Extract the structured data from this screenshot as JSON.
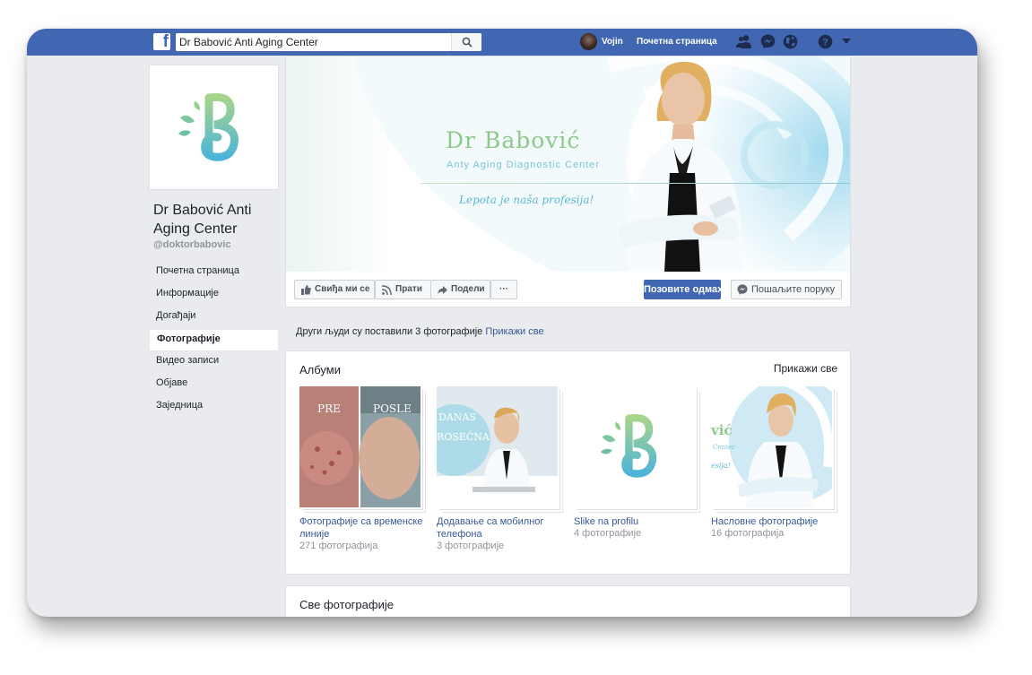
{
  "topbar": {
    "search_value": "Dr Babović Anti Aging Center",
    "user_name": "Vojin",
    "home_label": "Почетна страница",
    "icons": [
      "facebook-icon",
      "search-icon",
      "friends-icon",
      "messenger-icon",
      "globe-icon",
      "help-icon",
      "dropdown-icon"
    ]
  },
  "sidebar": {
    "page_name": "Dr Babović Anti Aging Center",
    "handle": "@doktorbabovic",
    "nav": [
      {
        "label": "Почетна страница"
      },
      {
        "label": "Информације"
      },
      {
        "label": "Догађаји"
      },
      {
        "label": "Фотографије",
        "active": true
      },
      {
        "label": "Видео записи"
      },
      {
        "label": "Објаве"
      },
      {
        "label": "Заједница"
      }
    ]
  },
  "cover": {
    "title": "Dr Babović",
    "subtitle": "Anty Aging Diagnostic Center",
    "slogan": "Lepota je naša profesija!"
  },
  "actions": {
    "like": "Свиђа ми се",
    "follow": "Прати",
    "share": "Подели",
    "more": "···",
    "call": "Позовите одмах",
    "message": "Пошаљите поруку"
  },
  "others": {
    "text": "Други људи су поставили 3 фотографије",
    "link": "Прикажи све"
  },
  "albums": {
    "title": "Албуми",
    "see_all": "Прикажи све",
    "items": [
      {
        "name": "Фотографије са временске линије",
        "count": "271 фотографија",
        "thumb_text": [
          "PRE",
          "POSLE"
        ]
      },
      {
        "name": "Додавање са мобилног телефона",
        "count": "3 фотографије",
        "thumb_text": [
          "DANAS",
          "ROSEČNA"
        ]
      },
      {
        "name": "Slike na profilu",
        "count": "4 фотографије",
        "thumb_text": []
      },
      {
        "name": "Насловне фотографије",
        "count": "16 фотографија",
        "thumb_text": [
          "vić",
          "Center",
          "esija!"
        ]
      }
    ]
  },
  "all_photos": {
    "title": "Све фотографије"
  },
  "colors": {
    "brand_blue": "#4267b2",
    "link_blue": "#365899",
    "logo_green": "#8cc98a",
    "logo_teal": "#5bb8d6"
  }
}
